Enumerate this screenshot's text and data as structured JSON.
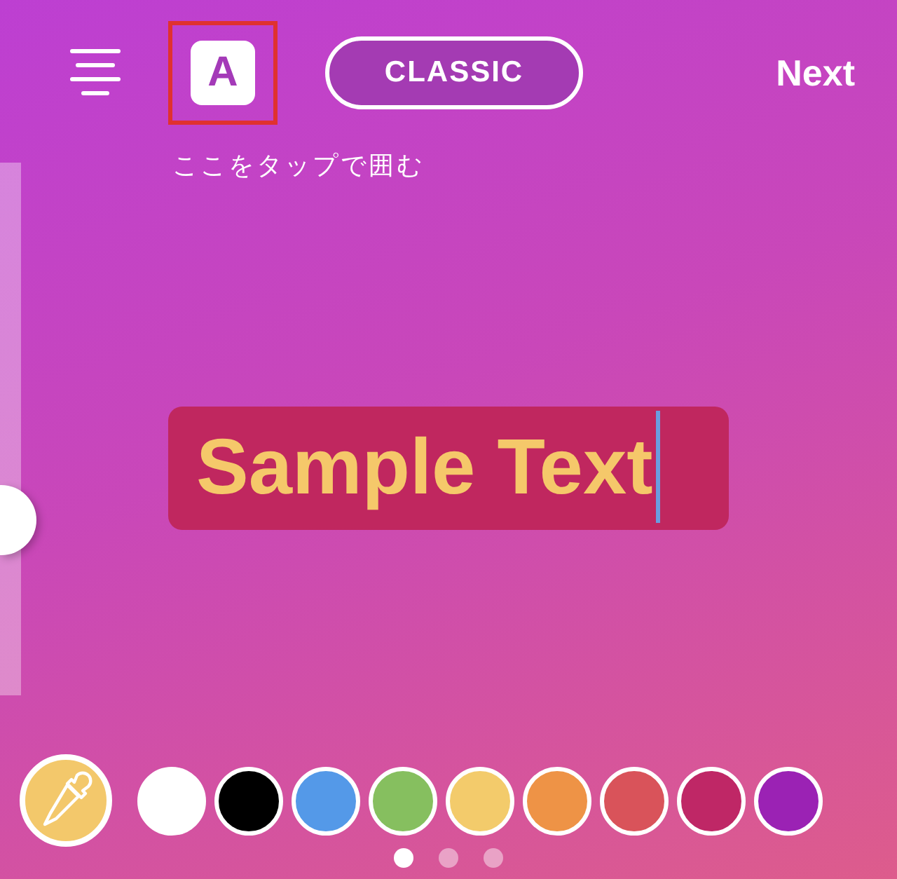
{
  "toolbar": {
    "font_button": {
      "label": "A",
      "highlighted": true
    },
    "style_button": {
      "label": "CLASSIC"
    },
    "next": "Next"
  },
  "annotation": "ここをタップで囲む",
  "size_slider": {
    "level": 0.33
  },
  "text_box": {
    "text": "Sample Text"
  },
  "colors": [
    {
      "color": "#ffffff"
    },
    {
      "color": "#000000"
    },
    {
      "color": "#5499e8"
    },
    {
      "color": "#86bf5f"
    },
    {
      "color": "#f3cb6b"
    },
    {
      "color": "#ee9346"
    },
    {
      "color": "#d9535a"
    },
    {
      "color": "#bf2766"
    },
    {
      "color": "#9b22b4"
    }
  ],
  "pages": [
    {
      "selected": true
    },
    {
      "selected": false
    },
    {
      "selected": false
    }
  ]
}
